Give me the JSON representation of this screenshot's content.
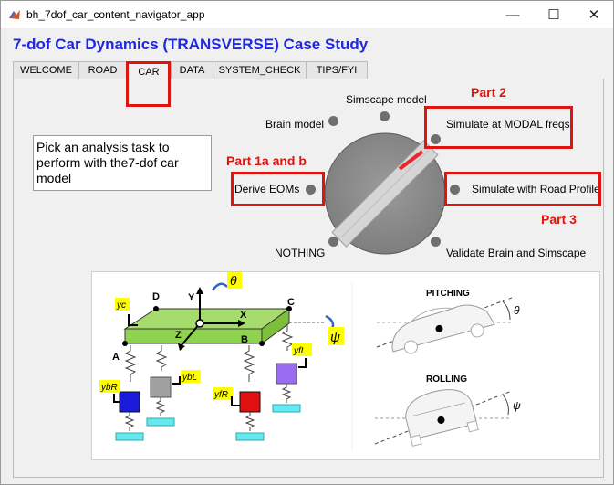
{
  "window": {
    "title": "bh_7dof_car_content_navigator_app",
    "minimize_glyph": "—",
    "maximize_glyph": "☐",
    "close_glyph": "✕"
  },
  "app": {
    "heading": "7-dof Car Dynamics (TRANSVERSE) Case Study"
  },
  "tabs": [
    {
      "label": "WELCOME"
    },
    {
      "label": "ROAD"
    },
    {
      "label": "CAR"
    },
    {
      "label": "DATA"
    },
    {
      "label": "SYSTEM_CHECK"
    },
    {
      "label": "TIPS/FYI"
    }
  ],
  "active_tab": "CAR",
  "task_prompt": "Pick an analysis task to perform with the7-dof car model",
  "knob": {
    "options": [
      {
        "label": "Simscape model"
      },
      {
        "label": "Brain model"
      },
      {
        "label": "Simulate at MODAL freqs"
      },
      {
        "label": "Derive EOMs"
      },
      {
        "label": "Simulate with Road Profile"
      },
      {
        "label": "NOTHING"
      },
      {
        "label": "Validate Brain and Simscape"
      }
    ],
    "selected": "Simulate at MODAL freqs"
  },
  "annotations": {
    "part2": "Part 2",
    "part1": "Part 1a  and  b",
    "part3": "Part 3"
  },
  "diagram": {
    "labels": {
      "yc": "yc",
      "ybR": "ybR",
      "ybL": "ybL",
      "yfR": "yfR",
      "yfL": "yfL",
      "A": "A",
      "B": "B",
      "C": "C",
      "D": "D",
      "X": "X",
      "Y": "Y",
      "Z": "Z",
      "theta": "θ",
      "psi": "ψ",
      "pitching": "PITCHING",
      "rolling": "ROLLING",
      "theta_small": "θ",
      "psi_small": "ψ"
    },
    "colors": {
      "body": "#8fd24e",
      "yellow_label": "#ffff00",
      "blue_wheel": "#1a1adb",
      "gray_wheel": "#a0a0a0",
      "red_wheel": "#e01010",
      "purple_wheel": "#9a6cf0",
      "road_pad": "#66e8f0"
    }
  },
  "colors": {
    "heading_blue": "#1f27e0",
    "highlight_red": "#e0140e",
    "knob_gray": "#8e8e8e"
  }
}
